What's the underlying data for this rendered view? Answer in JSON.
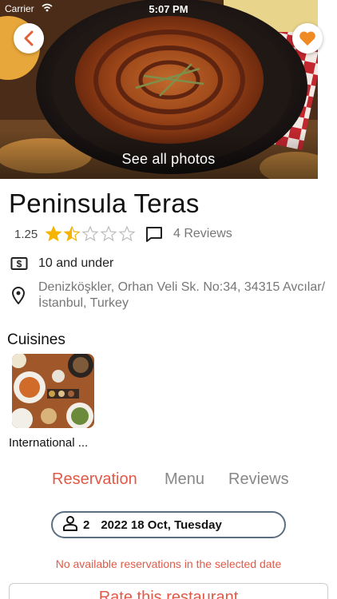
{
  "status_bar": {
    "carrier": "Carrier",
    "time": "5:07 PM"
  },
  "hero": {
    "see_all_photos": "See all photos"
  },
  "restaurant": {
    "name": "Peninsula Teras",
    "rating": "1.25",
    "rating_value": 1.25,
    "rating_max": 5,
    "reviews_label": "4 Reviews",
    "price": "10 and under",
    "address": "Denizköşkler, Orhan Veli Sk. No:34, 34315 Avcılar/İstanbul, Turkey"
  },
  "cuisines": {
    "title": "Cuisines",
    "items": [
      {
        "label": "International ..."
      }
    ]
  },
  "tabs": [
    {
      "label": "Reservation",
      "active": true
    },
    {
      "label": "Menu",
      "active": false
    },
    {
      "label": "Reviews",
      "active": false
    }
  ],
  "reservation": {
    "guests": "2",
    "date": "2022 18 Oct, Tuesday",
    "no_availability": "No available reservations in the selected date"
  },
  "rate_button": "Rate this restaurant",
  "colors": {
    "accent": "#e05a47",
    "star": "#f4b400",
    "favorite": "#f08a24",
    "pill_border": "#5b6f80"
  },
  "icons": [
    "back-chevron-icon",
    "heart-icon",
    "star-icon",
    "comment-icon",
    "dollar-icon",
    "location-pin-icon",
    "person-icon",
    "wifi-icon"
  ]
}
